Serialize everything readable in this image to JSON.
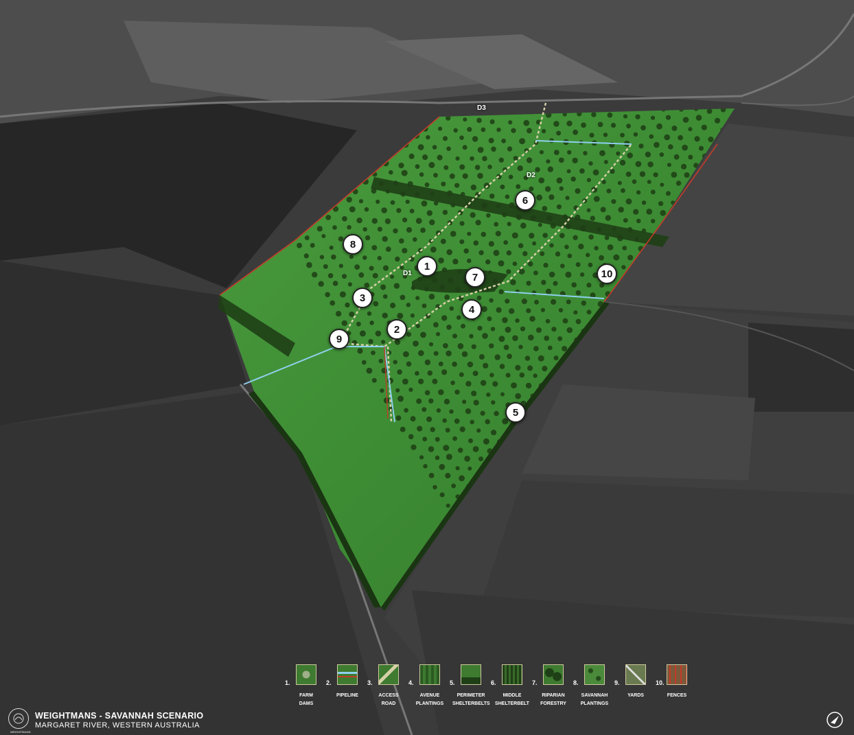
{
  "map": {
    "title": "WEIGHTMANS - SAVANNAH SCENARIO",
    "subtitle": "MARGARET RIVER, WESTERN AUSTRALIA",
    "logo_text": "WEIGHTMANS",
    "colors": {
      "field_green": "#3f8a36",
      "tree": "#1d3d14",
      "pipeline": "#8fd0ef",
      "fence": "#c33a2a",
      "surround": "#3a3a3a"
    },
    "markers": [
      "1",
      "2",
      "3",
      "4",
      "5",
      "6",
      "7",
      "8",
      "9",
      "10"
    ],
    "dams": [
      "D1",
      "D2",
      "D3"
    ]
  },
  "legend": [
    {
      "number": "1.",
      "label_line1": "FARM",
      "label_line2": "DAMS",
      "icon": "farm-dams-icon"
    },
    {
      "number": "2.",
      "label_line1": "PIPELINE",
      "label_line2": "",
      "icon": "pipeline-icon"
    },
    {
      "number": "3.",
      "label_line1": "ACCESS",
      "label_line2": "ROAD",
      "icon": "access-road-icon"
    },
    {
      "number": "4.",
      "label_line1": "AVENUE",
      "label_line2": "PLANTINGS",
      "icon": "avenue-plantings-icon"
    },
    {
      "number": "5.",
      "label_line1": "PERIMETER",
      "label_line2": "SHELTERBELTS",
      "icon": "perimeter-shelterbelts-icon"
    },
    {
      "number": "6.",
      "label_line1": "MIDDLE",
      "label_line2": "SHELTERBELT",
      "icon": "middle-shelterbelt-icon"
    },
    {
      "number": "7.",
      "label_line1": "RIPARIAN",
      "label_line2": "FORESTRY",
      "icon": "riparian-forestry-icon"
    },
    {
      "number": "8.",
      "label_line1": "SAVANNAH",
      "label_line2": "PLANTINGS",
      "icon": "savannah-plantings-icon"
    },
    {
      "number": "9.",
      "label_line1": "YARDS",
      "label_line2": "",
      "icon": "yards-icon"
    },
    {
      "number": "10.",
      "label_line1": "FENCES",
      "label_line2": "",
      "icon": "fences-icon"
    }
  ]
}
